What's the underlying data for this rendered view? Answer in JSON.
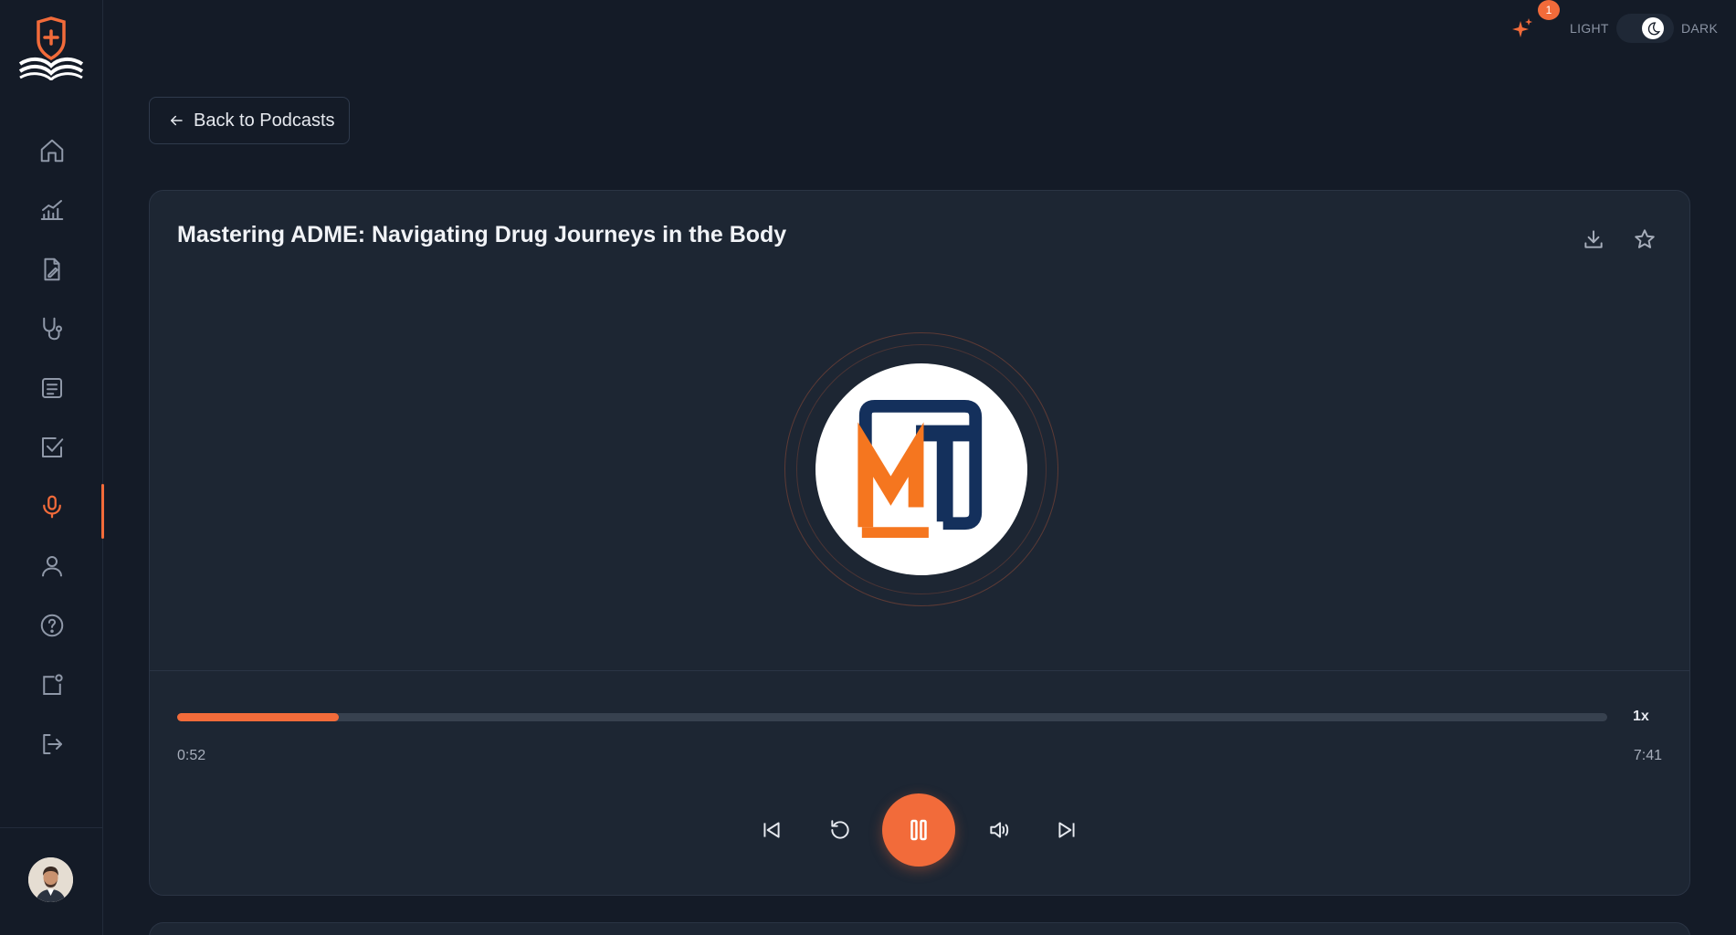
{
  "header": {
    "theme_light_label": "LIGHT",
    "theme_dark_label": "DARK",
    "notification_count": "1",
    "theme_mode": "dark"
  },
  "sidebar": {
    "items": [
      {
        "name": "home",
        "icon": "home-icon"
      },
      {
        "name": "analytics",
        "icon": "chart-icon"
      },
      {
        "name": "notes",
        "icon": "document-edit-icon"
      },
      {
        "name": "clinical",
        "icon": "stethoscope-icon"
      },
      {
        "name": "articles",
        "icon": "article-icon"
      },
      {
        "name": "quizzes",
        "icon": "checkbox-icon"
      },
      {
        "name": "podcasts",
        "icon": "microphone-icon",
        "active": true
      },
      {
        "name": "profile",
        "icon": "user-icon"
      },
      {
        "name": "help",
        "icon": "help-icon"
      },
      {
        "name": "notifications",
        "icon": "notification-icon"
      },
      {
        "name": "logout",
        "icon": "logout-icon"
      }
    ]
  },
  "back_button": {
    "label": "Back to Podcasts"
  },
  "player": {
    "title": "Mastering ADME: Navigating Drug Journeys in the Body",
    "current_time": "0:52",
    "total_time": "7:41",
    "progress_fraction": 0.113,
    "speed": "1x",
    "is_playing": true
  },
  "colors": {
    "accent": "#f26b3a",
    "background": "#141b27",
    "card": "#1d2633",
    "brand_navy": "#14305c"
  }
}
